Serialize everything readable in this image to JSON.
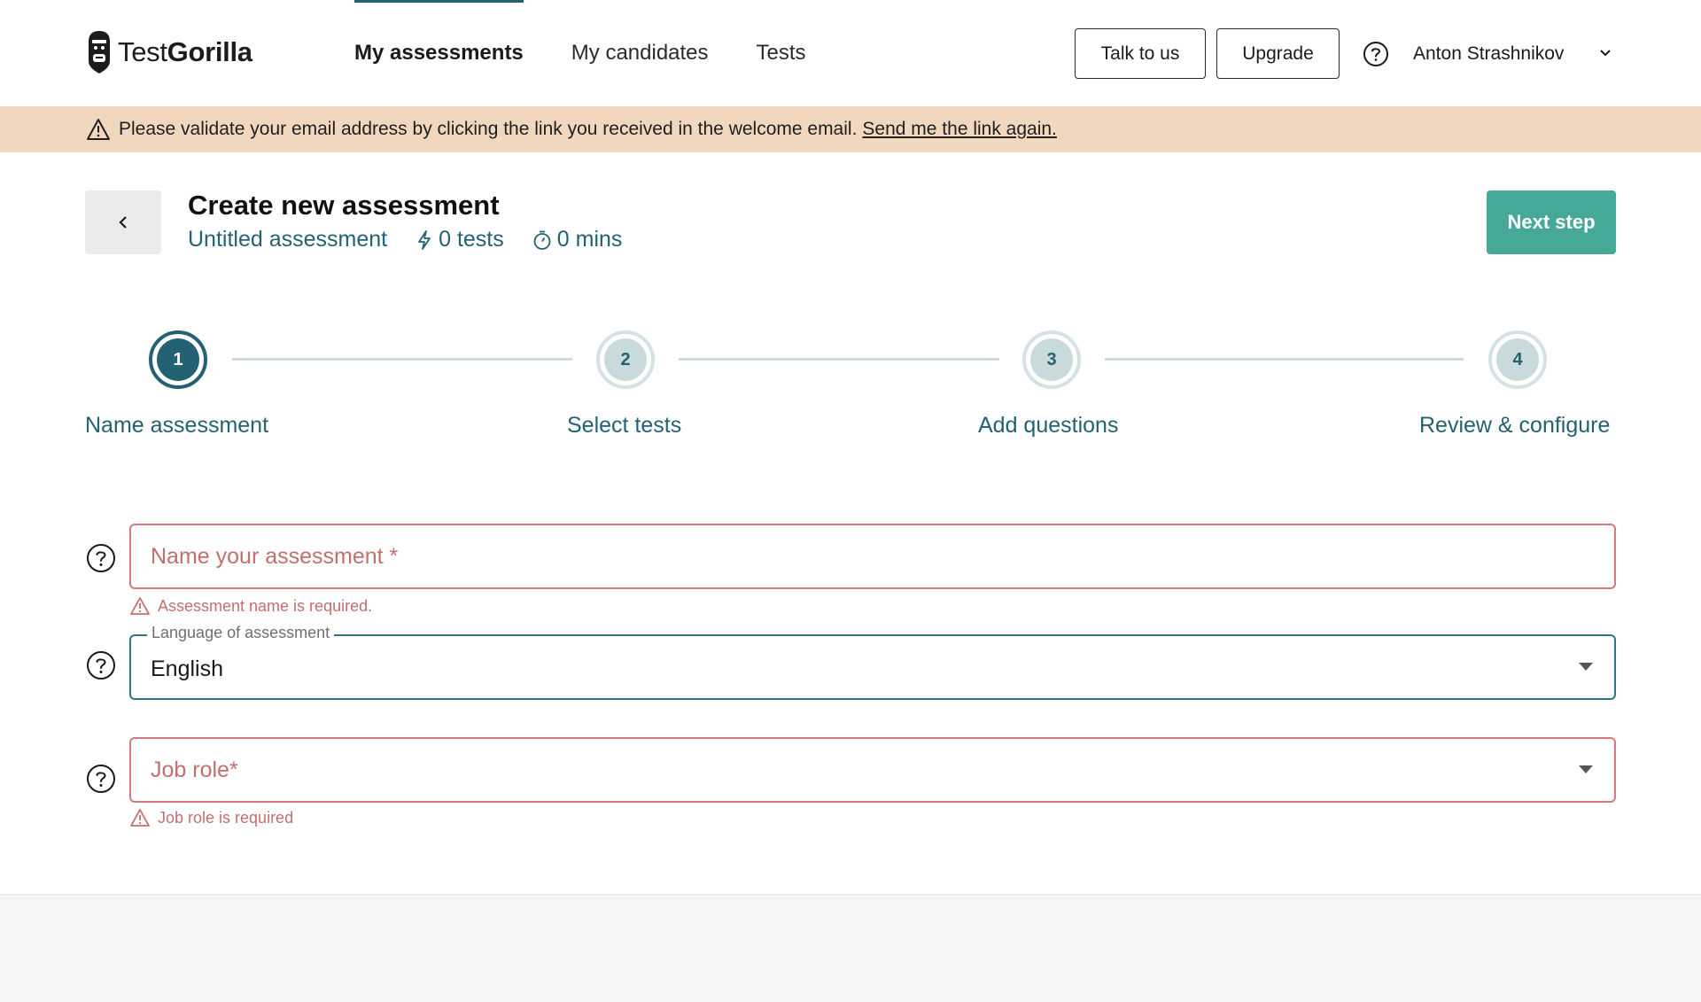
{
  "brand": {
    "name_light": "Test",
    "name_bold": "Gorilla",
    "primary_color": "#246173",
    "accent_color": "#46a997",
    "error_color": "#c2706f"
  },
  "nav": {
    "items": [
      {
        "label": "My assessments",
        "active": true
      },
      {
        "label": "My candidates",
        "active": false
      },
      {
        "label": "Tests",
        "active": false
      }
    ]
  },
  "header": {
    "talk_label": "Talk to us",
    "upgrade_label": "Upgrade",
    "user_name": "Anton Strashnikov"
  },
  "banner": {
    "message": "Please validate your email address by clicking the link you received in the welcome email.",
    "link_text": "Send me the link again."
  },
  "page": {
    "title": "Create new assessment",
    "assessment_name": "Untitled assessment",
    "tests_count": "0 tests",
    "duration": "0 mins",
    "next_label": "Next step"
  },
  "stepper": {
    "steps": [
      {
        "number": "1",
        "label": "Name assessment",
        "state": "active"
      },
      {
        "number": "2",
        "label": "Select tests",
        "state": "pending"
      },
      {
        "number": "3",
        "label": "Add questions",
        "state": "pending"
      },
      {
        "number": "4",
        "label": "Review & configure",
        "state": "pending"
      }
    ]
  },
  "form": {
    "name_field": {
      "placeholder": "Name your assessment *",
      "value": "",
      "error": "Assessment name is required."
    },
    "language_field": {
      "label": "Language of assessment",
      "value": "English"
    },
    "job_role_field": {
      "placeholder": "Job role*",
      "value": "",
      "error": "Job role is required"
    }
  }
}
